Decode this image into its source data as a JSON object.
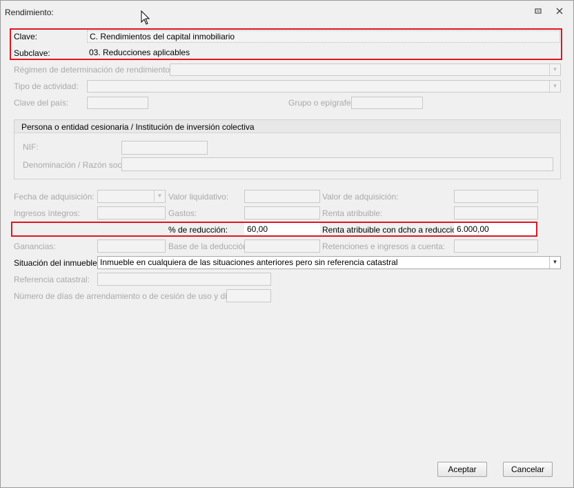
{
  "window": {
    "title": "Rendimiento:",
    "restore_icon": "restore-icon",
    "close_icon": "close-icon"
  },
  "clave": {
    "label": "Clave:",
    "value": "C. Rendimientos del capital inmobiliario"
  },
  "subclave": {
    "label": "Subclave:",
    "value": "03. Reducciones aplicables"
  },
  "regimen": {
    "label": "Régimen de determinación de rendimientos:",
    "value": ""
  },
  "tipo_actividad": {
    "label": "Tipo de actividad:",
    "value": ""
  },
  "clave_pais": {
    "label": "Clave del país:",
    "value": ""
  },
  "grupo_epigrafe": {
    "label": "Grupo o epígrafe:",
    "value": ""
  },
  "entidad": {
    "title": "Persona o entidad cesionaria / Institución de inversión colectiva",
    "nif_label": "NIF:",
    "nif_value": "",
    "denominacion_label": "Denominación / Razón social:",
    "denominacion_value": ""
  },
  "fecha_adquisicion": {
    "label": "Fecha de adquisición:",
    "value": ""
  },
  "valor_liquidativo": {
    "label": "Valor liquidativo:",
    "value": ""
  },
  "valor_adquisicion": {
    "label": "Valor de adquisición:",
    "value": ""
  },
  "ingresos_integros": {
    "label": "Ingresos íntegros:",
    "value": ""
  },
  "gastos": {
    "label": "Gastos:",
    "value": ""
  },
  "renta_atribuible": {
    "label": "Renta atribuible:",
    "value": ""
  },
  "reduccion": {
    "label": "% de reducción:",
    "value": "60,00"
  },
  "renta_reduccion": {
    "label": "Renta atribuible con dcho a reducción:",
    "value": "6.000,00"
  },
  "ganancias": {
    "label": "Ganancias:",
    "value": ""
  },
  "base_deduccion": {
    "label": "Base de la deducción:",
    "value": ""
  },
  "retenciones": {
    "label": "Retenciones e ingresos a cuenta:",
    "value": ""
  },
  "situacion": {
    "label": "Situación del inmueble:",
    "value": "Inmueble en cualquiera de las situaciones anteriores pero sin referencia catastral"
  },
  "referencia_catastral": {
    "label": "Referencia catastral:",
    "value": ""
  },
  "dias_arrendamiento": {
    "label": "Número de días de arrendamiento o de cesión de uso y disfrute",
    "value": ""
  },
  "buttons": {
    "accept": "Aceptar",
    "cancel": "Cancelar"
  },
  "colors": {
    "highlight": "#e0141e",
    "disabled_text": "#a9a9a9"
  }
}
